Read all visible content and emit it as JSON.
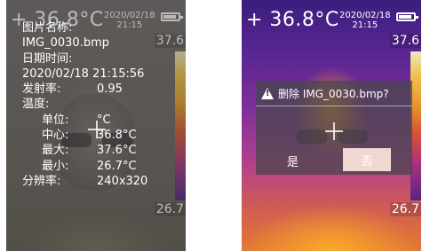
{
  "left_screen": {
    "status": {
      "temperature": "+ 36.8°C",
      "date": "2020/02/18",
      "time": "21:15"
    },
    "scale": {
      "max": "37.6",
      "min": "26.7"
    },
    "info": [
      {
        "key": "图片名称:",
        "value": ""
      },
      {
        "key": "IMG_0030.bmp",
        "value": ""
      },
      {
        "key": "日期时间:",
        "value": ""
      },
      {
        "key": "2020/02/18 21:15:56",
        "value": ""
      },
      {
        "key": "发射率:",
        "value": "0.95"
      },
      {
        "key": "温度:",
        "value": ""
      },
      {
        "key": "单位:",
        "value": "°C",
        "indent": true
      },
      {
        "key": "中心:",
        "value": "36.8°C",
        "indent": true
      },
      {
        "key": "最大:",
        "value": "37.6°C",
        "indent": true
      },
      {
        "key": "最小:",
        "value": "26.7°C",
        "indent": true
      },
      {
        "key": "分辨率:",
        "value": "240x320"
      }
    ]
  },
  "right_screen": {
    "status": {
      "temperature": "+ 36.8°C",
      "date": "2020/02/18",
      "time": "21:15"
    },
    "scale": {
      "max": "37.6",
      "min": "26.7"
    },
    "dialog": {
      "title": "删除 IMG_0030.bmp?",
      "yes_label": "是",
      "no_label": "否"
    }
  },
  "icons": [
    "battery-icon",
    "warning-icon",
    "crosshair-icon"
  ]
}
